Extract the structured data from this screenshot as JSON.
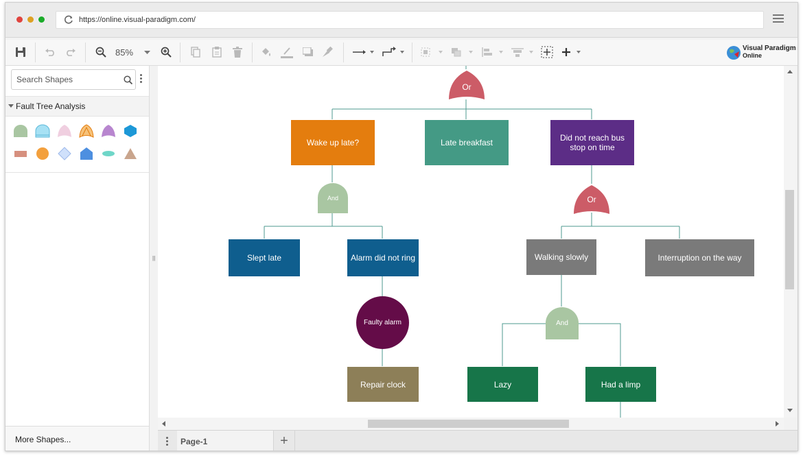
{
  "browser": {
    "url": "https://online.visual-paradigm.com/",
    "traffic_lights": [
      "#e0443e",
      "#dea123",
      "#1aab29"
    ]
  },
  "toolbar": {
    "zoom": "85%"
  },
  "brand": {
    "line1": "Visual Paradigm",
    "line2": "Online"
  },
  "sidebar": {
    "search_placeholder": "Search Shapes",
    "category": "Fault Tree Analysis",
    "more_shapes": "More Shapes..."
  },
  "pages": {
    "tab": "Page-1",
    "add": "+"
  },
  "diagram": {
    "gates": {
      "top_or": "Or",
      "and_left": "And",
      "or_right": "Or",
      "and_bottom": "And"
    },
    "events": {
      "wake_up_late": "Wake up late?",
      "late_breakfast": "Late breakfast",
      "missed_bus": "Did not reach bus stop on time",
      "slept_late": "Slept late",
      "alarm_did_not_ring": "Alarm did not ring",
      "faulty_alarm": "Faulty alarm",
      "repair_clock": "Repair clock",
      "walking_slowly": "Walking slowly",
      "interruption": "Interruption on the way",
      "lazy": "Lazy",
      "had_a_limp": "Had a limp"
    },
    "colors": {
      "or_gate": "#cc5c67",
      "and_gate": "#a9c6a2",
      "orange": "#e47d0e",
      "teal": "#449a85",
      "purple": "#5c2d86",
      "blue": "#0f5e8e",
      "maroon": "#640c48",
      "olive": "#8d7f58",
      "gray": "#7a7a7a",
      "green": "#177549",
      "connector": "#4c9a8f"
    }
  }
}
